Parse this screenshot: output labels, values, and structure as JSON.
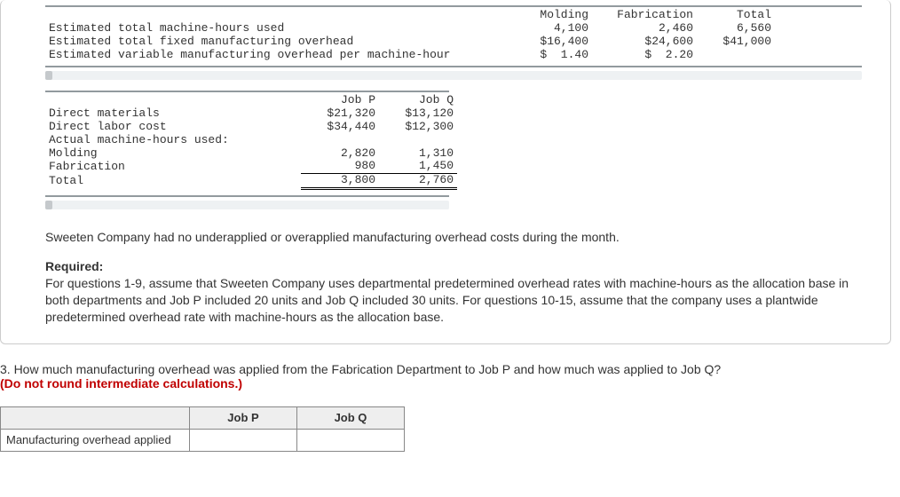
{
  "table1": {
    "headers": {
      "c1": "Molding",
      "c2": "Fabrication",
      "c3": "Total"
    },
    "rows": [
      {
        "label": "Estimated total machine-hours used",
        "c1": "4,100",
        "c2": "2,460",
        "c3": "6,560"
      },
      {
        "label": "Estimated total fixed manufacturing overhead",
        "c1": "$16,400",
        "c2": "$24,600",
        "c3": "$41,000"
      },
      {
        "label": "Estimated variable manufacturing overhead per machine-hour",
        "c1": "$  1.40",
        "c2": "$  2.20",
        "c3": ""
      }
    ]
  },
  "table2": {
    "headers": {
      "c1": "Job P",
      "c2": "Job Q"
    },
    "rows": [
      {
        "label": "Direct materials",
        "c1": "$21,320",
        "c2": "$13,120"
      },
      {
        "label": "Direct labor cost",
        "c1": "$34,440",
        "c2": "$12,300"
      },
      {
        "label": "Actual machine-hours used:",
        "c1": "",
        "c2": ""
      },
      {
        "label": "Molding",
        "c1": "2,820",
        "c2": "1,310"
      },
      {
        "label": "Fabrication",
        "c1": "980",
        "c2": "1,450",
        "uline": true
      },
      {
        "label": "Total",
        "c1": "3,800",
        "c2": "2,760",
        "dbl": true
      }
    ]
  },
  "para1": "Sweeten Company had no underapplied or overapplied manufacturing overhead costs during the month.",
  "req_label": "Required:",
  "para2": "For questions 1-9, assume that Sweeten Company uses departmental predetermined overhead rates with machine-hours as the allocation base in both departments and Job P included 20 units and Job Q included 30 units. For questions 10-15, assume that the company uses a plantwide predetermined overhead rate with machine-hours as the allocation base.",
  "question_main": "3. How much manufacturing overhead was applied from the Fabrication Department to Job P and how much was applied to Job Q? ",
  "question_red": "(Do not round intermediate calculations.)",
  "answer": {
    "h1": "Job P",
    "h2": "Job Q",
    "rowlabel": "Manufacturing overhead applied",
    "v1": "",
    "v2": ""
  },
  "chart_data": [
    {
      "type": "table",
      "title": "Departmental overhead estimates",
      "columns": [
        "Molding",
        "Fabrication",
        "Total"
      ],
      "rows": [
        {
          "label": "Estimated total machine-hours used",
          "values": [
            4100,
            2460,
            6560
          ]
        },
        {
          "label": "Estimated total fixed manufacturing overhead ($)",
          "values": [
            16400,
            24600,
            41000
          ]
        },
        {
          "label": "Estimated variable manufacturing overhead per machine-hour ($)",
          "values": [
            1.4,
            2.2,
            null
          ]
        }
      ]
    },
    {
      "type": "table",
      "title": "Job cost and actual machine-hours",
      "columns": [
        "Job P",
        "Job Q"
      ],
      "rows": [
        {
          "label": "Direct materials ($)",
          "values": [
            21320,
            13120
          ]
        },
        {
          "label": "Direct labor cost ($)",
          "values": [
            34440,
            12300
          ]
        },
        {
          "label": "Actual machine-hours used - Molding",
          "values": [
            2820,
            1310
          ]
        },
        {
          "label": "Actual machine-hours used - Fabrication",
          "values": [
            980,
            1450
          ]
        },
        {
          "label": "Actual machine-hours used - Total",
          "values": [
            3800,
            2760
          ]
        }
      ]
    }
  ]
}
